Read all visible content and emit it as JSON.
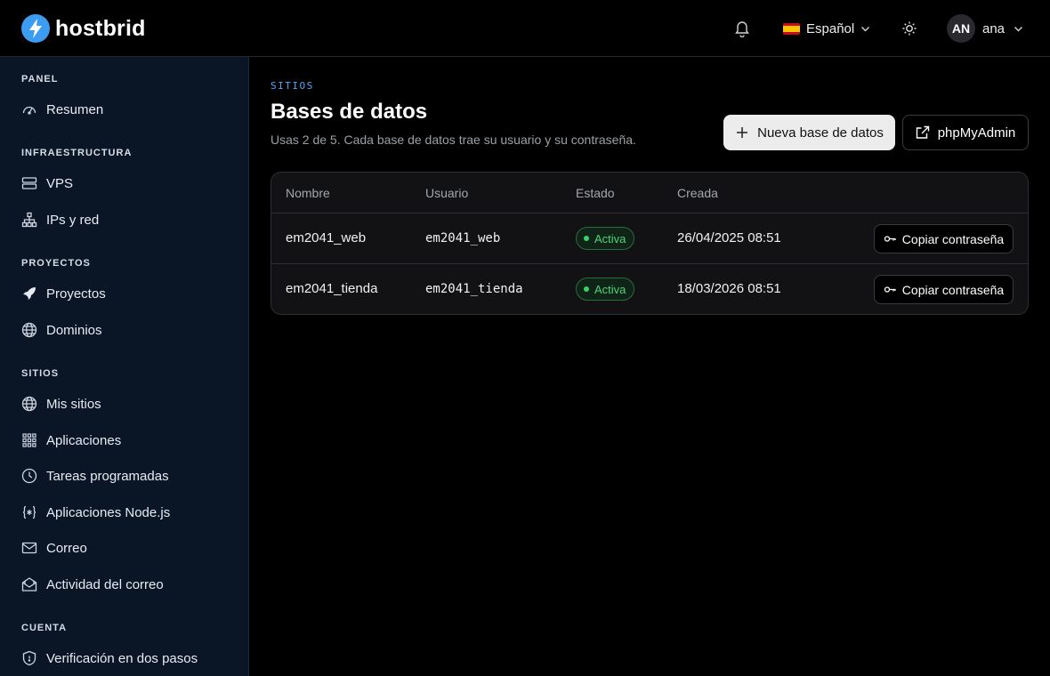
{
  "brand": {
    "name": "hostbrid"
  },
  "header": {
    "language": "Español",
    "user_initials": "AN",
    "user_name": "ana"
  },
  "sidebar": {
    "sections": [
      {
        "label": "PANEL"
      },
      {
        "label": "INFRAESTRUCTURA"
      },
      {
        "label": "PROYECTOS"
      },
      {
        "label": "SITIOS"
      },
      {
        "label": "CUENTA"
      }
    ],
    "items": [
      {
        "label": "Resumen",
        "icon": "gauge-icon"
      },
      {
        "label": "VPS",
        "icon": "server-icon"
      },
      {
        "label": "IPs y red",
        "icon": "network-icon"
      },
      {
        "label": "Proyectos",
        "icon": "rocket-icon"
      },
      {
        "label": "Dominios",
        "icon": "globe-icon"
      },
      {
        "label": "Mis sitios",
        "icon": "globe-icon"
      },
      {
        "label": "Aplicaciones",
        "icon": "grid-icon"
      },
      {
        "label": "Tareas programadas",
        "icon": "clock-icon"
      },
      {
        "label": "Aplicaciones Node.js",
        "icon": "code-braces-icon"
      },
      {
        "label": "Correo",
        "icon": "mail-icon"
      },
      {
        "label": "Actividad del correo",
        "icon": "mail-open-icon"
      },
      {
        "label": "Verificación en dos pasos",
        "icon": "shield-icon"
      }
    ]
  },
  "main": {
    "eyebrow": "SITIOS",
    "title": "Bases de datos",
    "subtitle": "Usas 2 de 5. Cada base de datos trae su usuario y su contraseña.",
    "new_button": "Nueva base de datos",
    "phpmyadmin_button": "phpMyAdmin",
    "table": {
      "headers": [
        "Nombre",
        "Usuario",
        "Estado",
        "Creada"
      ],
      "rows": [
        {
          "name": "em2041_web",
          "user": "em2041_web",
          "status": "Activa",
          "created": "26/04/2025 08:51",
          "action": "Copiar contraseña"
        },
        {
          "name": "em2041_tienda",
          "user": "em2041_tienda",
          "status": "Activa",
          "created": "18/03/2026 08:51",
          "action": "Copiar contraseña"
        }
      ]
    }
  },
  "colors": {
    "accent": "#3b9cf2",
    "sidebar_bg": "#0a1526",
    "status_active": "#4fd37a"
  }
}
